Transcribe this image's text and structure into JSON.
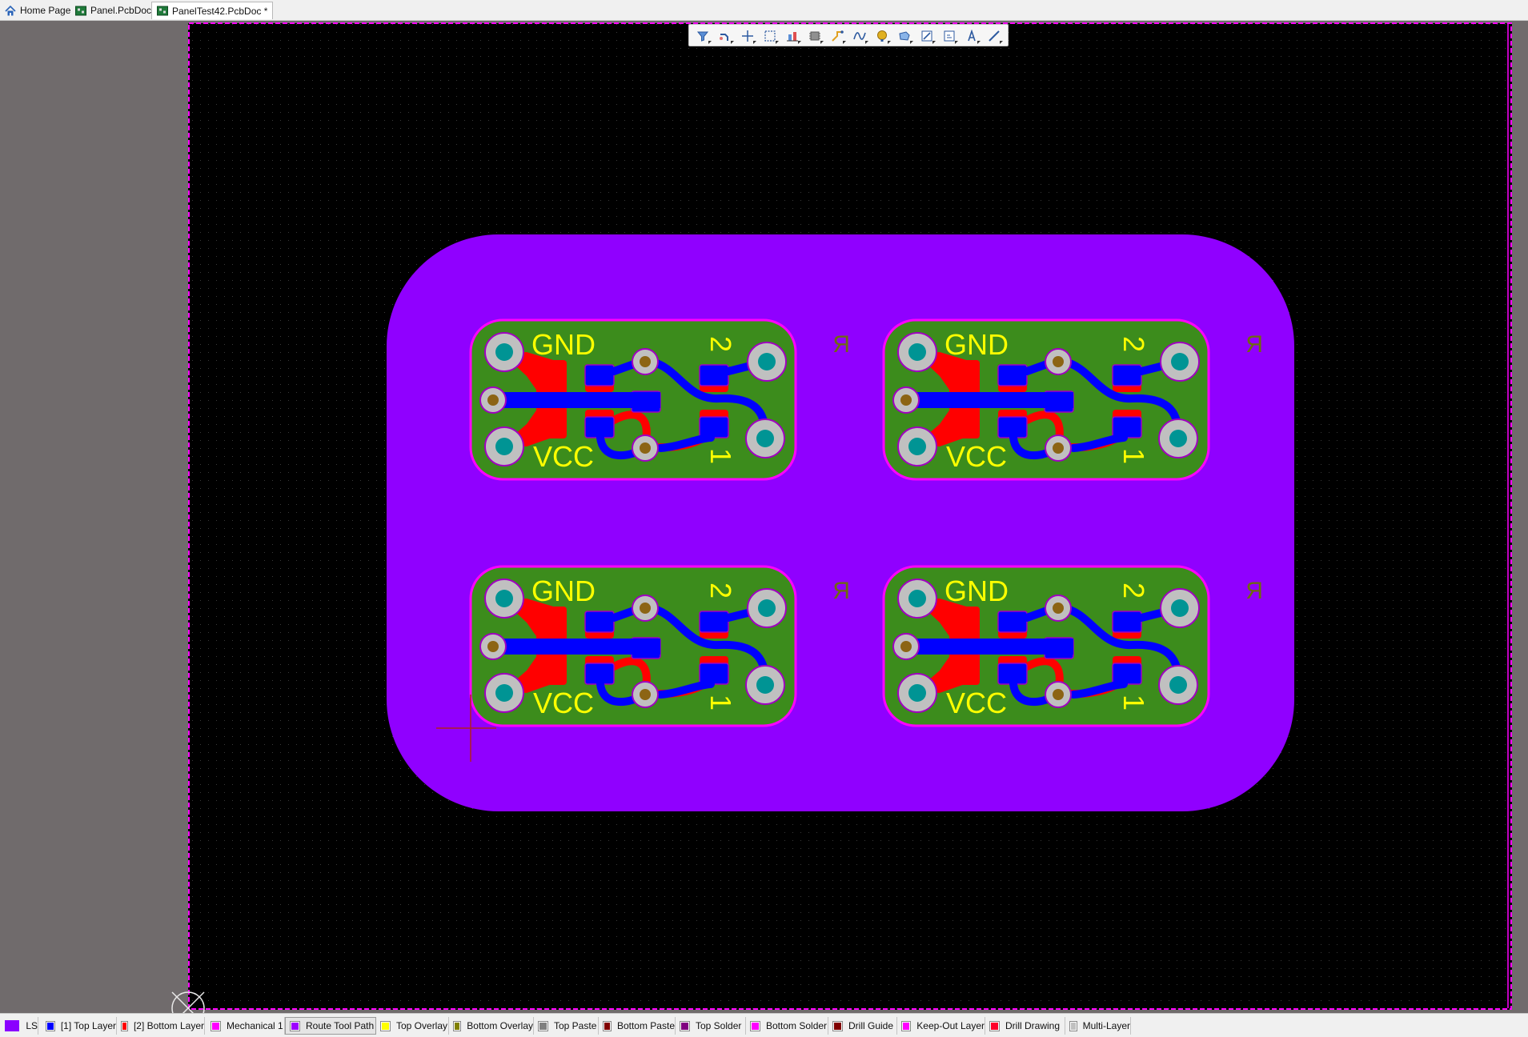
{
  "tabs": [
    {
      "label": "Home Page",
      "icon": "home-icon"
    },
    {
      "label": "Panel.PcbDoc",
      "icon": "pcb-doc-icon"
    },
    {
      "label": "PanelTest42.PcbDoc *",
      "icon": "pcb-doc-icon",
      "active": true
    }
  ],
  "toolbar": {
    "tools": [
      "filter-icon",
      "interactive-route-icon",
      "cross-probe-icon",
      "select-rectangle-icon",
      "align-icon",
      "place-component-icon",
      "route-icon",
      "differential-pair-icon",
      "place-pad-icon",
      "place-polygon-icon",
      "edit-icon",
      "place-text-frame-icon",
      "text-icon",
      "line-icon"
    ]
  },
  "boards": [
    {
      "gnd_label": "GND",
      "vcc_label": "VCC",
      "pin2_label": "2",
      "pin1_label": "1",
      "ghost_r": "R"
    },
    {
      "gnd_label": "GND",
      "vcc_label": "VCC",
      "pin2_label": "2",
      "pin1_label": "1",
      "ghost_r": "R"
    },
    {
      "gnd_label": "GND",
      "vcc_label": "VCC",
      "pin2_label": "2",
      "pin1_label": "1",
      "ghost_r": "R"
    },
    {
      "gnd_label": "GND",
      "vcc_label": "VCC",
      "pin2_label": "2",
      "pin1_label": "1",
      "ghost_r": "R"
    }
  ],
  "layers": [
    {
      "label": "LS",
      "color": "#8a00ff"
    },
    {
      "label": "[1] Top Layer",
      "color": "#0000ff"
    },
    {
      "label": "[2] Bottom Layer",
      "color": "#ff0000"
    },
    {
      "label": "Mechanical 1",
      "color": "#ff00ff"
    },
    {
      "label": "Route Tool Path",
      "color": "#9d00ff",
      "active": true
    },
    {
      "label": "Top Overlay",
      "color": "#ffff00"
    },
    {
      "label": "Bottom Overlay",
      "color": "#808000"
    },
    {
      "label": "Top Paste",
      "color": "#808080"
    },
    {
      "label": "Bottom Paste",
      "color": "#800000"
    },
    {
      "label": "Top Solder",
      "color": "#800080"
    },
    {
      "label": "Bottom Solder",
      "color": "#ff00ff"
    },
    {
      "label": "Drill Guide",
      "color": "#800000"
    },
    {
      "label": "Keep-Out Layer",
      "color": "#ff00ff"
    },
    {
      "label": "Drill Drawing",
      "color": "#ff002a"
    },
    {
      "label": "Multi-Layer",
      "color": "#c0c0c0"
    }
  ],
  "colors": {
    "workspace": "#706b6c",
    "sheet": "#000000",
    "keepout": "#ff00ff",
    "panel": "#9000ff",
    "board": "#3c8c1c",
    "top_layer": "#0000ff",
    "bottom_layer": "#ff0000",
    "overlay": "#ffff00",
    "pad": "#c0c0c0",
    "hole": "#009494",
    "via": "#8c6414"
  }
}
